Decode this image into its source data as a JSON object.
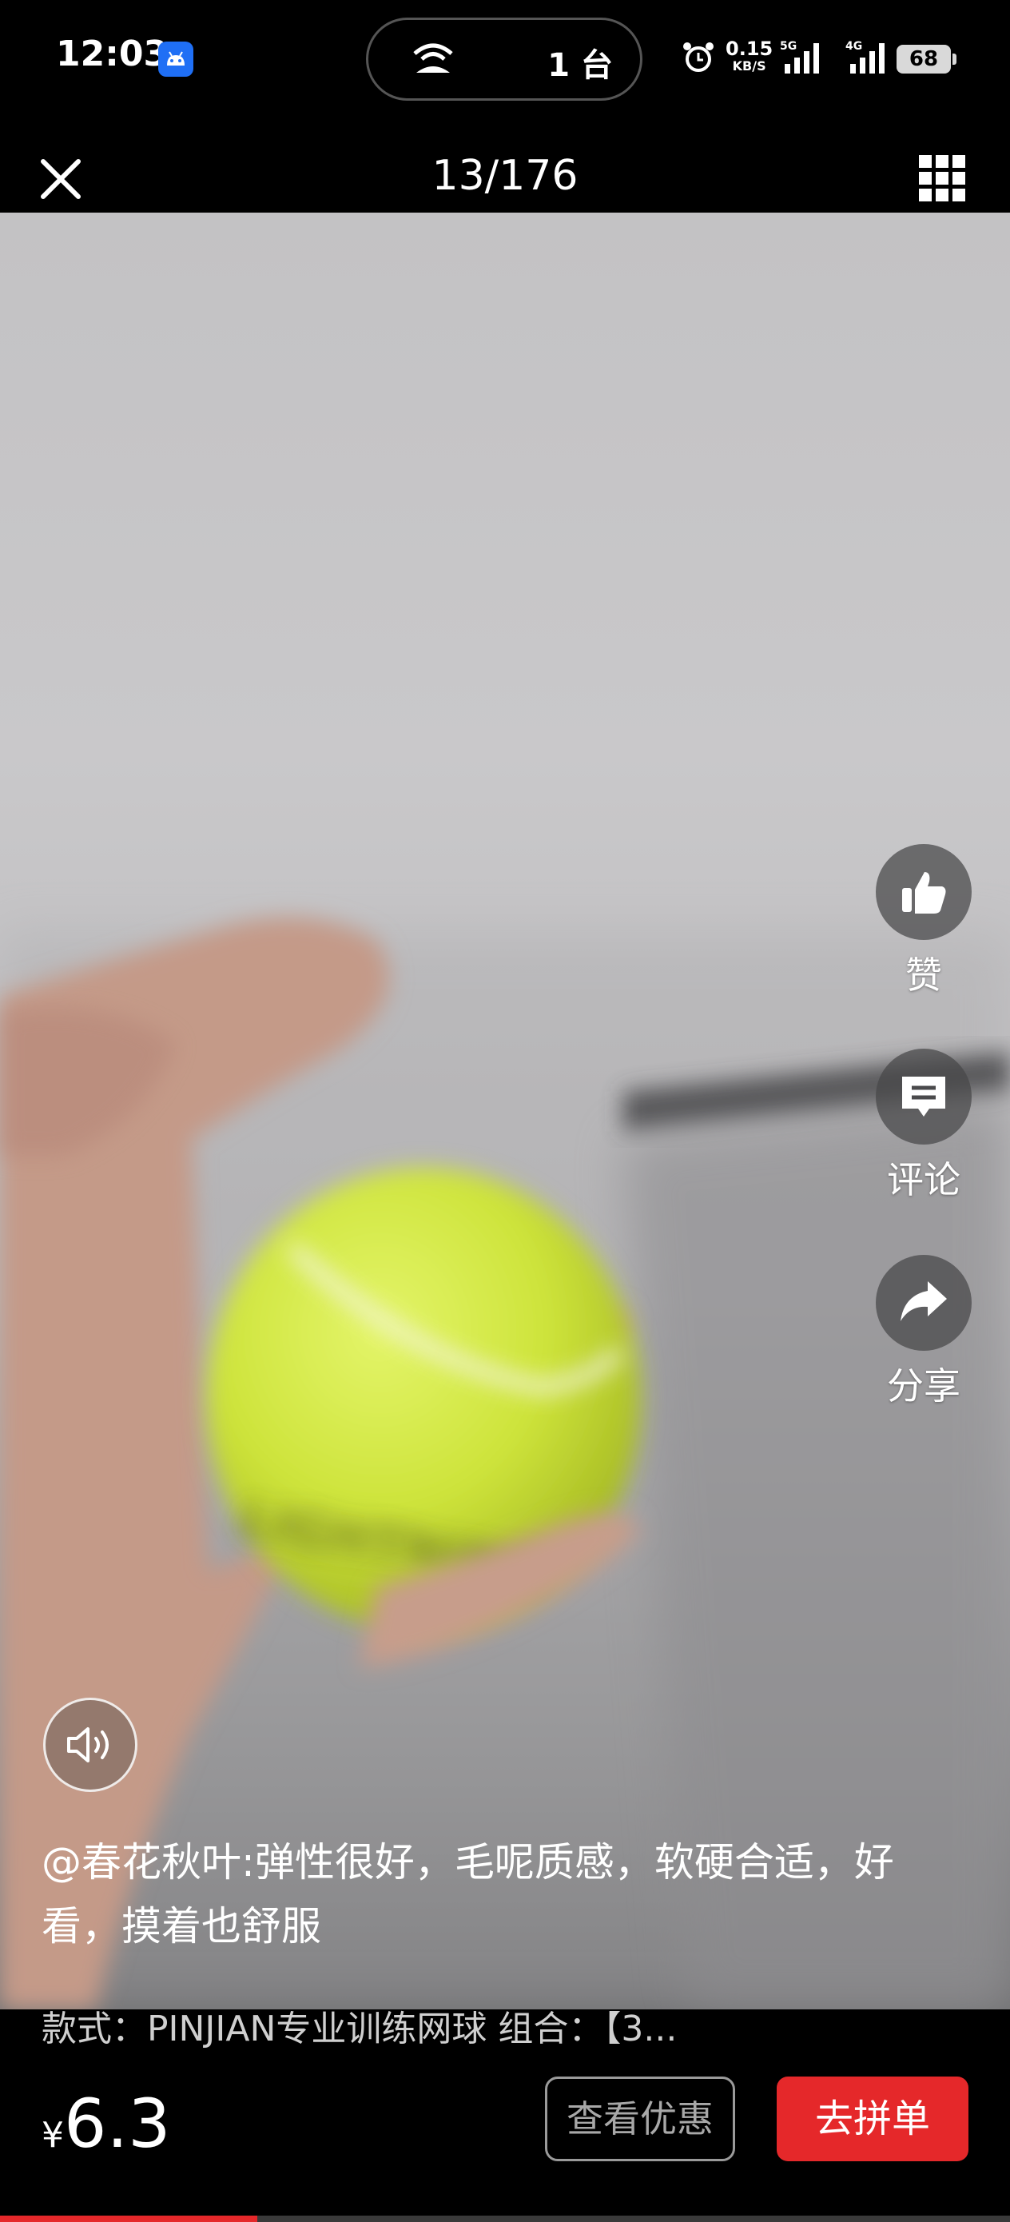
{
  "status_bar": {
    "time": "12:03",
    "devices": "1 台",
    "net_speed_value": "0.15",
    "net_speed_unit": "KB/S",
    "signal_1": "5G",
    "signal_2": "4G",
    "battery": "68"
  },
  "nav": {
    "page_counter": "13/176"
  },
  "actions": {
    "like_label": "赞",
    "comment_label": "评论",
    "share_label": "分享"
  },
  "review": {
    "text": "@春花秋叶:弹性很好，毛呢质感，软硬合适，好看，摸着也舒服"
  },
  "product": {
    "spec": "款式：PINJIAN专业训练网球  组合：【3...",
    "currency": "¥",
    "price": "6.3",
    "deal_button": "查看优惠",
    "buy_button": "去拼单"
  },
  "video_progress": 0.255,
  "colors": {
    "accent_red": "#e5282a",
    "background": "#000000"
  },
  "icons": [
    "android-app-icon",
    "hotspot-icon",
    "alarm-icon",
    "close-icon",
    "grid-icon",
    "thumbs-up-icon",
    "comment-icon",
    "share-icon",
    "speaker-icon"
  ]
}
